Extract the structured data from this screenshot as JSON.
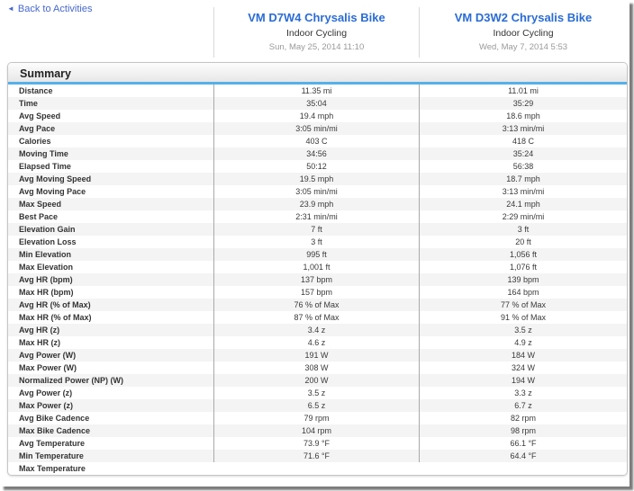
{
  "back_link": {
    "label": "Back to Activities",
    "icon_glyph": "◄"
  },
  "activities": [
    {
      "title": "VM D7W4 Chrysalis Bike",
      "type": "Indoor Cycling",
      "date": "Sun, May 25, 2014 11:10"
    },
    {
      "title": "VM D3W2 Chrysalis Bike",
      "type": "Indoor Cycling",
      "date": "Wed, May 7, 2014 5:53"
    }
  ],
  "summary": {
    "title": "Summary",
    "rows": [
      {
        "label": "Distance",
        "values": [
          "11.35 mi",
          "11.01 mi"
        ]
      },
      {
        "label": "Time",
        "values": [
          "35:04",
          "35:29"
        ]
      },
      {
        "label": "Avg Speed",
        "values": [
          "19.4 mph",
          "18.6 mph"
        ]
      },
      {
        "label": "Avg Pace",
        "values": [
          "3:05 min/mi",
          "3:13 min/mi"
        ]
      },
      {
        "label": "Calories",
        "values": [
          "403 C",
          "418 C"
        ]
      },
      {
        "label": "Moving Time",
        "values": [
          "34:56",
          "35:24"
        ]
      },
      {
        "label": "Elapsed Time",
        "values": [
          "50:12",
          "56:38"
        ]
      },
      {
        "label": "Avg Moving Speed",
        "values": [
          "19.5 mph",
          "18.7 mph"
        ]
      },
      {
        "label": "Avg Moving Pace",
        "values": [
          "3:05 min/mi",
          "3:13 min/mi"
        ]
      },
      {
        "label": "Max Speed",
        "values": [
          "23.9 mph",
          "24.1 mph"
        ]
      },
      {
        "label": "Best Pace",
        "values": [
          "2:31 min/mi",
          "2:29 min/mi"
        ]
      },
      {
        "label": "Elevation Gain",
        "values": [
          "7 ft",
          "3 ft"
        ]
      },
      {
        "label": "Elevation Loss",
        "values": [
          "3 ft",
          "20 ft"
        ]
      },
      {
        "label": "Min Elevation",
        "values": [
          "995 ft",
          "1,056 ft"
        ]
      },
      {
        "label": "Max Elevation",
        "values": [
          "1,001 ft",
          "1,076 ft"
        ]
      },
      {
        "label": "Avg HR (bpm)",
        "values": [
          "137 bpm",
          "139 bpm"
        ]
      },
      {
        "label": "Max HR (bpm)",
        "values": [
          "157 bpm",
          "164 bpm"
        ]
      },
      {
        "label": "Avg HR (% of Max)",
        "values": [
          "76 % of Max",
          "77 % of Max"
        ]
      },
      {
        "label": "Max HR (% of Max)",
        "values": [
          "87 % of Max",
          "91 % of Max"
        ]
      },
      {
        "label": "Avg HR (z)",
        "values": [
          "3.4 z",
          "3.5 z"
        ]
      },
      {
        "label": "Max HR (z)",
        "values": [
          "4.6 z",
          "4.9 z"
        ]
      },
      {
        "label": "Avg Power (W)",
        "values": [
          "191 W",
          "184 W"
        ]
      },
      {
        "label": "Max Power (W)",
        "values": [
          "308 W",
          "324 W"
        ]
      },
      {
        "label": "Normalized Power (NP) (W)",
        "values": [
          "200 W",
          "194 W"
        ]
      },
      {
        "label": "Avg Power (z)",
        "values": [
          "3.5 z",
          "3.3 z"
        ]
      },
      {
        "label": "Max Power (z)",
        "values": [
          "6.5 z",
          "6.7 z"
        ]
      },
      {
        "label": "Avg Bike Cadence",
        "values": [
          "79 rpm",
          "82 rpm"
        ]
      },
      {
        "label": "Max Bike Cadence",
        "values": [
          "104 rpm",
          "98 rpm"
        ]
      },
      {
        "label": "Avg Temperature",
        "values": [
          "73.9 °F",
          "66.1 °F"
        ]
      },
      {
        "label": "Min Temperature",
        "values": [
          "71.6 °F",
          "64.4 °F"
        ]
      },
      {
        "label": "Max Temperature",
        "values": [
          "",
          ""
        ]
      }
    ]
  },
  "colors": {
    "link_blue": "#4668d0",
    "title_blue": "#2a6cd5",
    "summary_accent_blue": "#56b0e8",
    "row_stripe": "#f4f4f4",
    "divider_gray": "#a9a9a9"
  }
}
